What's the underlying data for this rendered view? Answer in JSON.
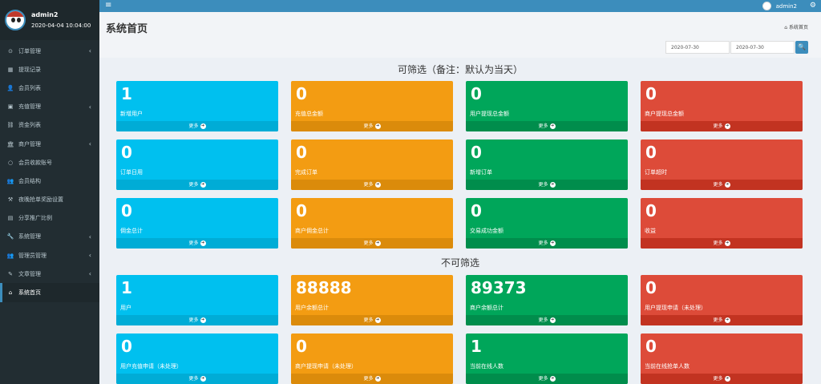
{
  "user": {
    "name": "admin2",
    "datetime": "2020-04-04 10:04:00"
  },
  "sidebar": {
    "items": [
      {
        "icon": "circle-icon",
        "glyph": "⊙",
        "label": "订单管理",
        "arrow": true
      },
      {
        "icon": "table-icon",
        "glyph": "▦",
        "label": "提现记录",
        "arrow": false
      },
      {
        "icon": "user-icon",
        "glyph": "👤",
        "label": "会员列表",
        "arrow": false
      },
      {
        "icon": "image-icon",
        "glyph": "▣",
        "label": "充值管理",
        "arrow": true
      },
      {
        "icon": "link-icon",
        "glyph": "⛓",
        "label": "资金列表",
        "arrow": false
      },
      {
        "icon": "bank-icon",
        "glyph": "🏛",
        "label": "商户管理",
        "arrow": true
      },
      {
        "icon": "circle-o-icon",
        "glyph": "○",
        "label": "会员收款账号",
        "arrow": false
      },
      {
        "icon": "users-icon",
        "glyph": "👥",
        "label": "会员结构",
        "arrow": false
      },
      {
        "icon": "gavel-icon",
        "glyph": "⚒",
        "label": "夜晚抢单奖励设置",
        "arrow": false
      },
      {
        "icon": "calc-icon",
        "glyph": "▤",
        "label": "分享推广比例",
        "arrow": false
      },
      {
        "icon": "wrench-icon",
        "glyph": "🔧",
        "label": "系统管理",
        "arrow": true
      },
      {
        "icon": "group-icon",
        "glyph": "👥",
        "label": "管理员管理",
        "arrow": true
      },
      {
        "icon": "edit-icon",
        "glyph": "✎",
        "label": "文章管理",
        "arrow": true
      },
      {
        "icon": "home-icon",
        "glyph": "⌂",
        "label": "系统首页",
        "arrow": false
      }
    ]
  },
  "topbar": {
    "toggle": "≡",
    "username": "admin2",
    "gear": "⚙"
  },
  "header": {
    "title": "系统首页",
    "breadcrumb_icon": "⌂",
    "breadcrumb": "系统首页",
    "date_start": "2020-07-30",
    "date_end": "2020-07-30",
    "search_icon": "🔍"
  },
  "sections": {
    "filterable": "可筛选（备注：默认为当天）",
    "not_filterable": "不可筛选"
  },
  "more_label": "更多",
  "more_icon": "➜",
  "colors": {
    "aqua": "#00c0ef",
    "yellow": "#f39c12",
    "green": "#00a65a",
    "red": "#dd4b39",
    "topbar": "#3c8dbc",
    "sidebar": "#222d32"
  },
  "stats": [
    {
      "value": "1",
      "label": "新增用户"
    },
    {
      "value": "0",
      "label": "充值总金额"
    },
    {
      "value": "0",
      "label": "用户提现总金额"
    },
    {
      "value": "0",
      "label": "商户提现总金额"
    },
    {
      "value": "0",
      "label": "订单日用"
    },
    {
      "value": "0",
      "label": "完成订单"
    },
    {
      "value": "0",
      "label": "新增订单"
    },
    {
      "value": "0",
      "label": "订单超时"
    },
    {
      "value": "0",
      "label": "佣金总计"
    },
    {
      "value": "0",
      "label": "商户佣金总计"
    },
    {
      "value": "0",
      "label": "交易成功金额"
    },
    {
      "value": "0",
      "label": "收益"
    },
    {
      "value": "1",
      "label": "用户"
    },
    {
      "value": "88888",
      "label": "用户余额总计"
    },
    {
      "value": "89373",
      "label": "商户余额总计"
    },
    {
      "value": "0",
      "label": "用户提现申请（未处理）"
    },
    {
      "value": "0",
      "label": "用户充值申请（未处理）"
    },
    {
      "value": "0",
      "label": "商户提现申请（未处理）"
    },
    {
      "value": "1",
      "label": "当前在线人数"
    },
    {
      "value": "0",
      "label": "当前在线抢单人数"
    }
  ]
}
